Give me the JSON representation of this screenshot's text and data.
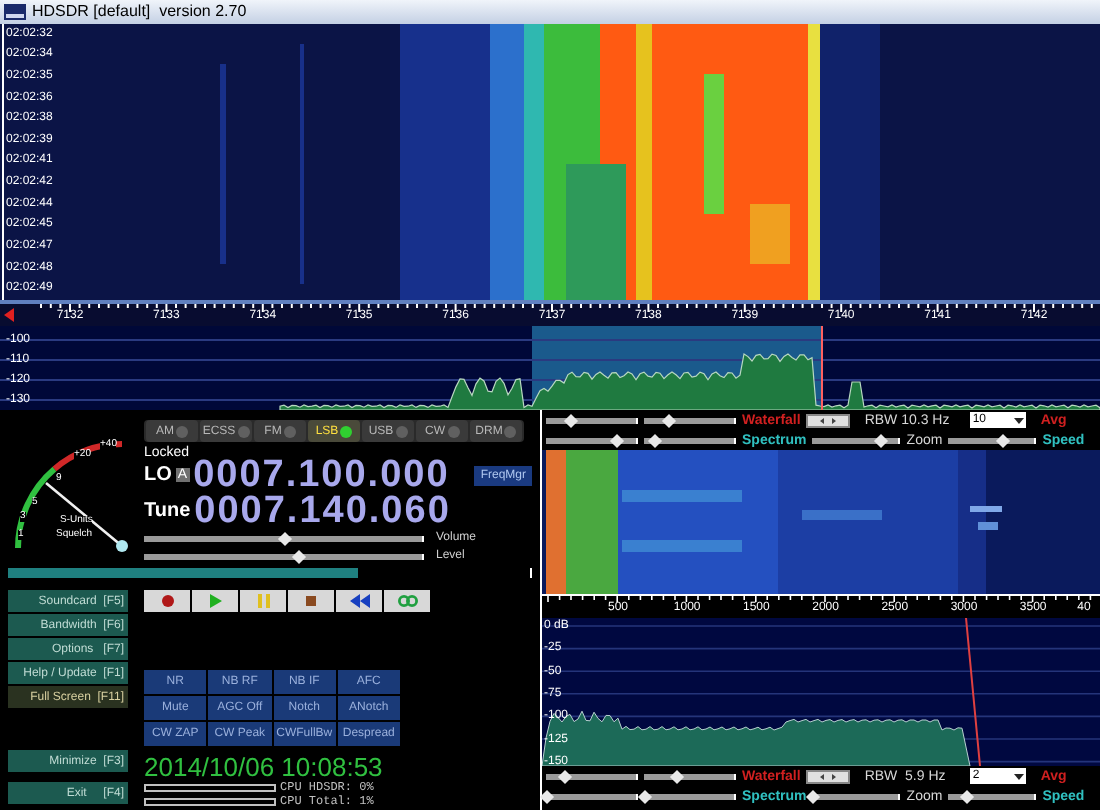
{
  "window": {
    "title": "HDSDR [default]  version 2.70"
  },
  "waterfall": {
    "times": [
      "02:02:32",
      "02:02:34",
      "02:02:35",
      "02:02:36",
      "02:02:38",
      "02:02:39",
      "02:02:41",
      "02:02:42",
      "02:02:44",
      "02:02:45",
      "02:02:47",
      "02:02:48",
      "02:02:49"
    ]
  },
  "frequency_axis": {
    "labels": [
      "7132",
      "7133",
      "7134",
      "7135",
      "7136",
      "7137",
      "7138",
      "7139",
      "7140",
      "7141",
      "7142"
    ]
  },
  "spectrum": {
    "db_labels": [
      "-100",
      "-110",
      "-120",
      "-130"
    ]
  },
  "s_meter": {
    "labels": [
      "+40",
      "+20",
      "9",
      "5",
      "3",
      "1"
    ],
    "caption": "S-Units",
    "squelch": "Squelch"
  },
  "modes": [
    {
      "label": "AM",
      "selected": false
    },
    {
      "label": "ECSS",
      "selected": false
    },
    {
      "label": "FM",
      "selected": false
    },
    {
      "label": "LSB",
      "selected": true
    },
    {
      "label": "USB",
      "selected": false
    },
    {
      "label": "CW",
      "selected": false
    },
    {
      "label": "DRM",
      "selected": false
    }
  ],
  "lo": {
    "status": "Locked",
    "label": "LO",
    "lock_key": "A",
    "frequency": "0007.100.000"
  },
  "freq_manager": "FreqMgr",
  "tune": {
    "label": "Tune",
    "frequency": "0007.140.060"
  },
  "audio_sliders": [
    {
      "label": "Volume",
      "level": 0.5
    },
    {
      "label": "Level",
      "level": 0.55
    }
  ],
  "buffer_bar": {
    "level": 0.67
  },
  "side_buttons": [
    {
      "label": "Soundcard  [F5]",
      "active": false
    },
    {
      "label": "Bandwidth  [F6]",
      "active": false
    },
    {
      "label": "Options   [F7]",
      "active": false
    },
    {
      "label": "Help / Update  [F1]",
      "active": false
    },
    {
      "label": "Full Screen  [F11]",
      "active": true
    }
  ],
  "window_buttons": [
    {
      "label": "Minimize  [F3]"
    },
    {
      "label": "Exit     [F4]"
    }
  ],
  "transport": [
    {
      "kind": "record"
    },
    {
      "kind": "play"
    },
    {
      "kind": "pause"
    },
    {
      "kind": "stop"
    },
    {
      "kind": "rewind"
    },
    {
      "kind": "loop"
    }
  ],
  "dsp_buttons": [
    "NR",
    "NB RF",
    "NB IF",
    "AFC",
    "Mute",
    "AGC Off",
    "Notch",
    "ANotch",
    "CW ZAP",
    "CW Peak",
    "CWFullBw",
    "Despread"
  ],
  "clock": "2014/10/06 10:08:53",
  "cpu": [
    "CPU HDSDR: 0%",
    "CPU Total: 1%"
  ],
  "rf_controls": {
    "waterfall_sliders": [
      {
        "level": 0.25
      },
      {
        "level": 0.25
      }
    ],
    "waterfall_label": "Waterfall",
    "rbw": "RBW 10.3 Hz",
    "avg_value": "10",
    "avg_label": "Avg",
    "spectrum_sliders": [
      {
        "level": 0.75
      },
      {
        "level": 0.1
      }
    ],
    "spectrum_label": "Spectrum",
    "zoom": {
      "label": "Zoom",
      "level": 0.77
    },
    "speed": {
      "label": "Speed",
      "level": 0.6
    }
  },
  "audio_axis": {
    "labels": [
      "500",
      "1000",
      "1500",
      "2000",
      "2500",
      "3000",
      "3500",
      "40"
    ]
  },
  "audio_spectrum": {
    "db_labels": [
      "0 dB",
      "-25",
      "-50",
      "-75",
      "-100",
      "-125",
      "-150"
    ]
  },
  "af_controls": {
    "waterfall_sliders": [
      {
        "level": 0.2
      },
      {
        "level": 0.35
      }
    ],
    "waterfall_label": "Waterfall",
    "rbw": "RBW  5.9 Hz",
    "avg_value": "2",
    "avg_label": "Avg",
    "spectrum_sliders": [
      {
        "level": 0.0
      },
      {
        "level": 0.0
      }
    ],
    "spectrum_label": "Spectrum",
    "zoom": {
      "label": "Zoom",
      "level": 0.0
    },
    "speed": {
      "label": "Speed",
      "level": 0.2
    }
  }
}
